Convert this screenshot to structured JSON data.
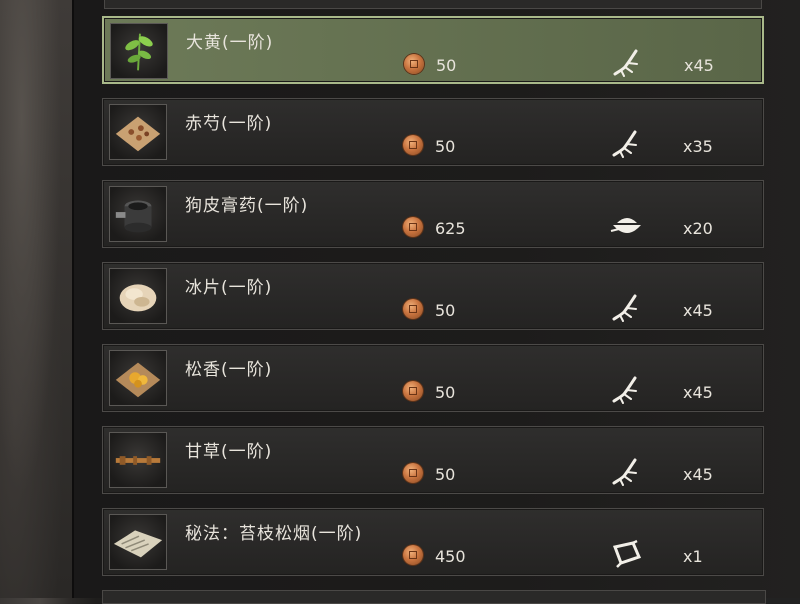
{
  "items": [
    {
      "name": "大黄(一阶)",
      "price": "50",
      "qty": "x45",
      "icon": "herb-root-icon",
      "thumb": "rhubarb",
      "selected": true
    },
    {
      "name": "赤芍(一阶)",
      "price": "50",
      "qty": "x35",
      "icon": "herb-root-icon",
      "thumb": "peony"
    },
    {
      "name": "狗皮膏药(一阶)",
      "price": "625",
      "qty": "x20",
      "icon": "bowl-icon",
      "thumb": "plaster"
    },
    {
      "name": "冰片(一阶)",
      "price": "50",
      "qty": "x45",
      "icon": "herb-root-icon",
      "thumb": "borneol"
    },
    {
      "name": "松香(一阶)",
      "price": "50",
      "qty": "x45",
      "icon": "herb-root-icon",
      "thumb": "rosin"
    },
    {
      "name": "甘草(一阶)",
      "price": "50",
      "qty": "x45",
      "icon": "herb-root-icon",
      "thumb": "licorice"
    },
    {
      "name": "秘法：苔枝松烟(一阶)",
      "price": "450",
      "qty": "x1",
      "icon": "scroll-icon",
      "thumb": "recipe"
    }
  ]
}
